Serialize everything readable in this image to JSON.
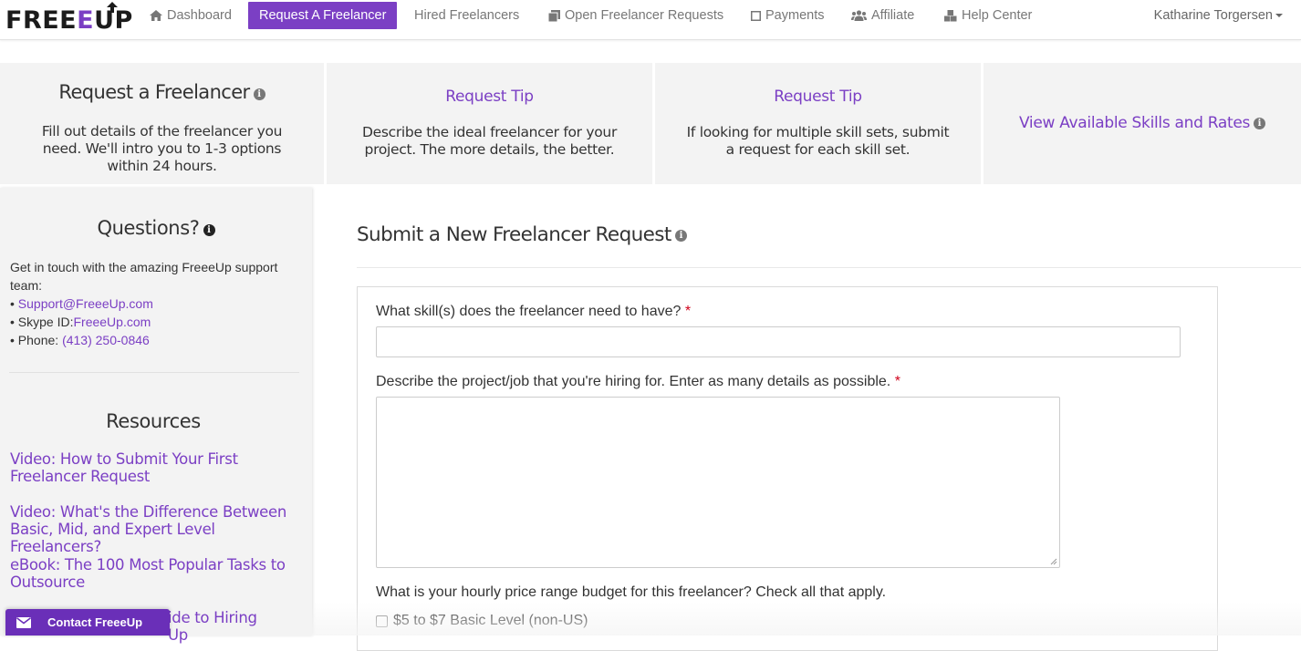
{
  "brand": {
    "logo_text_pre": "FREE",
    "logo_e": "E",
    "logo_text_post": "UP",
    "accent": "#7b3fc4"
  },
  "nav": {
    "dashboard": "Dashboard",
    "request_freelancer": "Request A Freelancer",
    "hired_freelancers": "Hired Freelancers",
    "open_requests": "Open Freelancer Requests",
    "payments": "Payments",
    "affiliate": "Affiliate",
    "help_center": "Help Center",
    "user_name": "Katharine Torgersen"
  },
  "tips": [
    {
      "title": "Request a Freelancer",
      "body_lines": [
        "Fill out details of the freelancer you",
        "need. We'll intro you to 1-3 options",
        "within 24 hours."
      ]
    },
    {
      "title": "Request Tip",
      "body_lines": [
        "Describe the ideal freelancer for your",
        "project. The more details, the better."
      ]
    },
    {
      "title": "Request Tip",
      "body_lines": [
        "If looking for multiple skill sets, submit",
        "a request for each skill set."
      ]
    },
    {
      "title": "View Available Skills and Rates"
    }
  ],
  "sidebar": {
    "questions_heading": "Questions?",
    "intro_line1": "Get in touch with the amazing FreeeUp support",
    "intro_line2": "team:",
    "support_bullet": "• ",
    "support_email": "Support@FreeeUp.com",
    "skype_label": "• Skype ID:",
    "skype_id": "FreeeUp.com",
    "phone_label": "• Phone: ",
    "phone": "(413) 250-0846",
    "resources_heading": "Resources",
    "resources": [
      {
        "line1": "Video: How to Submit Your First",
        "line2": "Freelancer Request"
      },
      {
        "line1": "Video: What's the Difference Between",
        "line2": "Basic, Mid, and Expert Level Freelancers?"
      },
      {
        "line1": "eBook: The 100 Most Popular Tasks to",
        "line2": "Outsource"
      },
      {
        "line1": "ide to Hiring",
        "line2": "Up"
      }
    ]
  },
  "main": {
    "title": "Submit a New Freelancer Request",
    "q_skills": "What skill(s) does the freelancer need to have?",
    "q_project": "Describe the project/job that you're hiring for. Enter as many details as possible.",
    "q_budget": "What is your hourly price range budget for this freelancer? Check all that apply.",
    "required_mark": "*",
    "budget_option_1": "$5 to $7 Basic Level (non-US)",
    "skills_value": "",
    "project_value": ""
  },
  "contact_button": "Contact FreeeUp"
}
